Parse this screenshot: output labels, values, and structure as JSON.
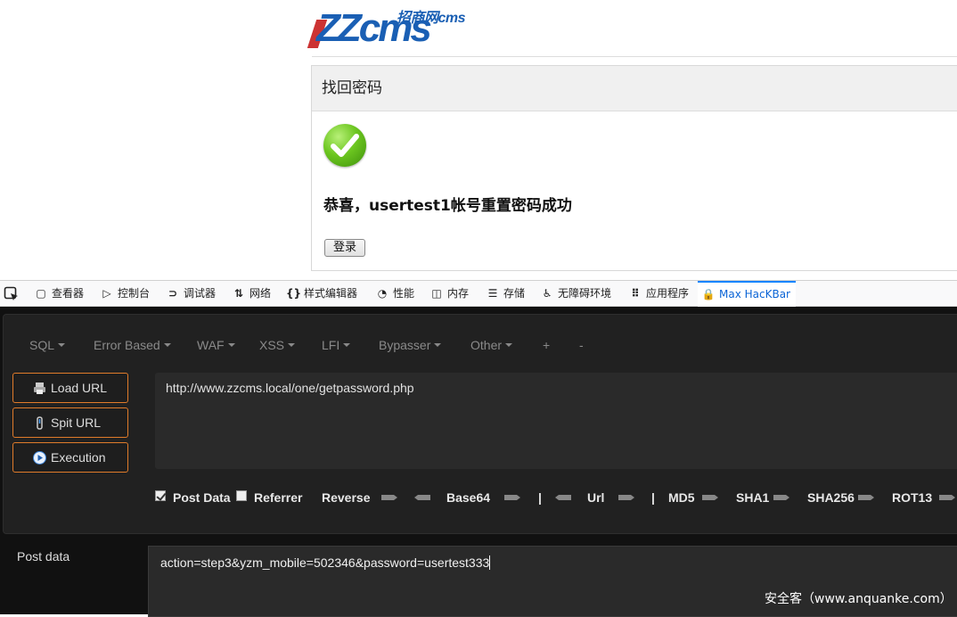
{
  "site": {
    "logo_main": "ZZcms",
    "logo_sub": "招商网cms"
  },
  "panel": {
    "title": "找回密码",
    "message": "恭喜，usertest1帐号重置密码成功",
    "login_button": "登录"
  },
  "devtools": {
    "tabs": [
      {
        "label": "查看器",
        "icon": "inspector-icon"
      },
      {
        "label": "控制台",
        "icon": "console-icon"
      },
      {
        "label": "调试器",
        "icon": "debugger-icon"
      },
      {
        "label": "网络",
        "icon": "network-icon"
      },
      {
        "label": "样式编辑器",
        "icon": "style-editor-icon"
      },
      {
        "label": "性能",
        "icon": "performance-icon"
      },
      {
        "label": "内存",
        "icon": "memory-icon"
      },
      {
        "label": "存储",
        "icon": "storage-icon"
      },
      {
        "label": "无障碍环境",
        "icon": "accessibility-icon"
      },
      {
        "label": "应用程序",
        "icon": "application-icon"
      },
      {
        "label": "Max HacKBar",
        "icon": "lock-icon"
      }
    ],
    "active_tab": "Max HacKBar"
  },
  "hackbar": {
    "menu": [
      "SQL",
      "Error Based",
      "WAF",
      "XSS",
      "LFI",
      "Bypasser",
      "Other",
      "+",
      "-"
    ],
    "buttons": {
      "load_url": "Load URL",
      "split_url": "Spit URL",
      "execution": "Execution"
    },
    "url": "http://www.zzcms.local/one/getpassword.php",
    "options": {
      "post_data": "Post Data",
      "post_data_checked": true,
      "referrer": "Referrer",
      "referrer_checked": false,
      "reverse": "Reverse",
      "base64": "Base64",
      "sep1": "|",
      "url": "Url",
      "sep2": "|",
      "md5": "MD5",
      "sha1": "SHA1",
      "sha256": "SHA256",
      "rot13": "ROT13"
    },
    "post_label": "Post data",
    "post_value": "action=step3&yzm_mobile=502346&password=usertest333",
    "accent_color": "#e07b2a"
  },
  "watermark": "安全客（www.anquanke.com）"
}
